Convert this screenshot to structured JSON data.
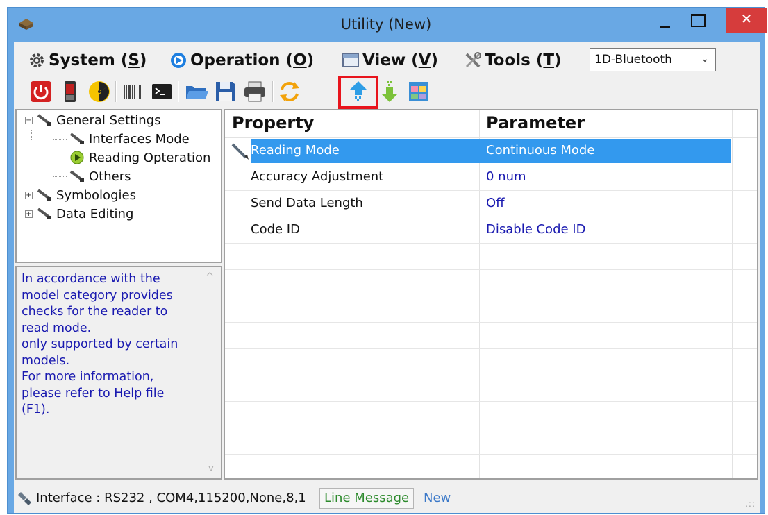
{
  "window": {
    "title": "Utility (New)",
    "close_glyph": "✕",
    "colors": {
      "frame": "#69a8e4",
      "close": "#d63c3c",
      "highlight": "#e8141c",
      "selection": "#3399ee"
    }
  },
  "menu": {
    "items": [
      {
        "name": "system",
        "label_pre": "System (",
        "accel": "S",
        "label_post": ")",
        "icon": "gear-icon"
      },
      {
        "name": "operation",
        "label_pre": "Operation (",
        "accel": "O",
        "label_post": ")",
        "icon": "play-circle-icon"
      },
      {
        "name": "view",
        "label_pre": "View (",
        "accel": "V",
        "label_post": ")",
        "icon": "window-icon"
      },
      {
        "name": "tools",
        "label_pre": "Tools (",
        "accel": "T",
        "label_post": ")",
        "icon": "tools-icon"
      }
    ],
    "device_select": {
      "value": "1D-Bluetooth",
      "arrow": "⌄"
    }
  },
  "toolbar": {
    "buttons": [
      "power-icon",
      "phone-reader-icon",
      "radiation-icon",
      "barcode-icon",
      "terminal-icon",
      "open-folder-icon",
      "save-disk-icon",
      "printer-icon",
      "sync-arrows-icon",
      "upload-arrow-icon",
      "download-arrow-icon",
      "grid-config-icon"
    ],
    "highlighted": "upload-arrow-icon"
  },
  "tree": {
    "nodes": [
      {
        "label": "General Settings",
        "expander": "−"
      },
      {
        "label": "Interfaces Mode"
      },
      {
        "label": "Reading Opteration"
      },
      {
        "label": "Others"
      },
      {
        "label": "Symbologies",
        "expander": "+"
      },
      {
        "label": "Data Editing",
        "expander": "+"
      }
    ]
  },
  "description": {
    "text": "In accordance with the\nmodel category provides\nchecks for the reader to\nread mode.\n only supported by certain\nmodels.\nFor more information,\nplease refer to Help file\n(F1).",
    "scroll_up": "^",
    "scroll_down": "v"
  },
  "grid": {
    "header": {
      "property": "Property",
      "parameter": "Parameter"
    },
    "rows": [
      {
        "property": "Reading Mode",
        "parameter": "Continuous Mode",
        "selected": true
      },
      {
        "property": "Accuracy Adjustment",
        "parameter": "0 num"
      },
      {
        "property": "Send Data Length",
        "parameter": "Off"
      },
      {
        "property": "Code ID",
        "parameter": "Disable Code ID"
      }
    ]
  },
  "status": {
    "interface": "Interface : RS232 , COM4,115200,None,8,1",
    "line_message": "Line Message",
    "new_label": "New",
    "grip": ".::"
  }
}
